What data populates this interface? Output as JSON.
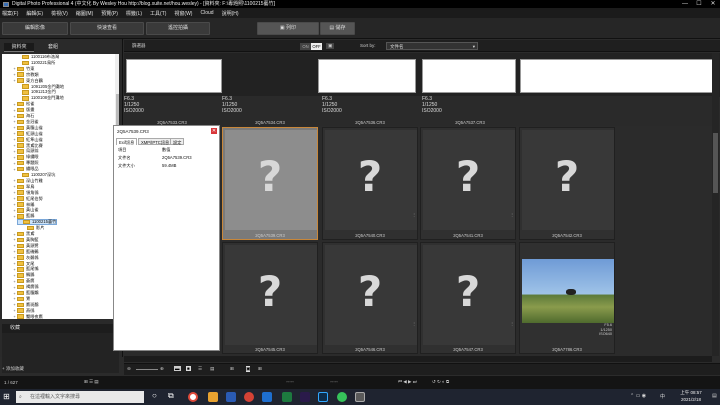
{
  "window": {
    "title": "Digital Photo Professional 4 (中文化 By Wesley Hou http://blog.xuite.net/hou.wesley) - [資料夾: F:\\專題照\\1100215藝竹]",
    "minimize": "—",
    "maximize": "☐",
    "close": "✕"
  },
  "menu": [
    "檔案(F)",
    "編輯(E)",
    "檢視(V)",
    "縮圖(M)",
    "預覽(P)",
    "標籤(L)",
    "工具(T)",
    "視窗(W)",
    "Cloud",
    "說明(H)"
  ],
  "toolbar": {
    "edit_image": "編輯影像",
    "quick_check": "快速查看",
    "batch_edit": "遙控拍攝",
    "print": "列印",
    "save": "儲存"
  },
  "left_panel": {
    "tab_folder": "資料夾",
    "tab_collection": "套組",
    "tree": [
      {
        "label": "1100116布洛灣",
        "level": 3
      },
      {
        "label": "1100221鳥所",
        "level": 3
      },
      {
        "label": "竹東",
        "level": 2
      },
      {
        "label": "宗教類",
        "level": 2
      },
      {
        "label": "東方白鸛",
        "level": 2
      },
      {
        "label": "1091205金門灘地",
        "level": 3
      },
      {
        "label": "1091213金門",
        "level": 3
      },
      {
        "label": "1100108金門灘地",
        "level": 3
      },
      {
        "label": "松雀",
        "level": 2
      },
      {
        "label": "版畫",
        "level": 2
      },
      {
        "label": "海石",
        "level": 2
      },
      {
        "label": "金冠雀",
        "level": 2
      },
      {
        "label": "黃腹山雀",
        "level": 2
      },
      {
        "label": "紅頭山雀",
        "level": 2
      },
      {
        "label": "紅隼山雀",
        "level": 2
      },
      {
        "label": "黑鳶比賽",
        "level": 2
      },
      {
        "label": "烏頭翁",
        "level": 2
      },
      {
        "label": "綠繡眼",
        "level": 2
      },
      {
        "label": "專題照",
        "level": 2
      },
      {
        "label": "繡眼品",
        "level": 2
      },
      {
        "label": "1100207深坑",
        "level": 3
      },
      {
        "label": "深山竹雞",
        "level": 2
      },
      {
        "label": "翠鳥",
        "level": 2
      },
      {
        "label": "領角鴞",
        "level": 2
      },
      {
        "label": "紅尾伯勞",
        "level": 2
      },
      {
        "label": "林鵰",
        "level": 2
      },
      {
        "label": "黃山雀",
        "level": 2
      },
      {
        "label": "藍鵲",
        "level": 2
      },
      {
        "label": "1100215藝竹",
        "level": 3,
        "selected": true
      },
      {
        "label": "影片",
        "level": 4
      },
      {
        "label": "黑鳶",
        "level": 2
      },
      {
        "label": "黃胸藍",
        "level": 2
      },
      {
        "label": "黃頭鷺",
        "level": 2
      },
      {
        "label": "藍磯鶇",
        "level": 2
      },
      {
        "label": "灰鶺鴒",
        "level": 2
      },
      {
        "label": "叉尾",
        "level": 2
      },
      {
        "label": "藍尾鴝",
        "level": 2
      },
      {
        "label": "鵂鶹",
        "level": 2
      },
      {
        "label": "蒼鷹",
        "level": 2
      },
      {
        "label": "褐鷹鴞",
        "level": 2
      },
      {
        "label": "藍腹鷴",
        "level": 2
      },
      {
        "label": "鵟",
        "level": 2
      },
      {
        "label": "鷹斑鷸",
        "level": 2
      },
      {
        "label": "燕鴴",
        "level": 2
      },
      {
        "label": "蟹眼夜鷹",
        "level": 2
      }
    ],
    "favorites_tab": "收藏",
    "add_favorite": "+ 添加收藏"
  },
  "filter_bar": {
    "filter_label": "篩選器",
    "toggle_on": "ON",
    "toggle_off": "OFF",
    "sort_label": "Sort by:",
    "sort_value": "文件名"
  },
  "top_row": [
    {
      "name": "2Q5A7533.CR3",
      "exif": [
        "F6.3",
        "1/1250",
        "ISO2000"
      ]
    },
    {
      "name": "2Q5A7534.CR3",
      "exif": [
        "F6.3",
        "1/1250",
        "ISO2000"
      ]
    },
    {
      "name": "2Q5A7536.CR3",
      "exif": [
        "F6.3",
        "1/1250",
        "ISO2000"
      ]
    },
    {
      "name": "2Q5A7537.CR3",
      "exif": [
        "F6.3",
        "1/1250",
        "ISO2000"
      ]
    }
  ],
  "grid_row1": [
    {
      "name": "2Q5A7539.CR3",
      "selected": true
    },
    {
      "name": "2Q5A7540.CR3"
    },
    {
      "name": "2Q5A7541.CR3"
    },
    {
      "name": "2Q5A7542.CR3"
    }
  ],
  "grid_row2": [
    {
      "name": "2Q5A7545.CR3"
    },
    {
      "name": "2Q5A7546.CR3"
    },
    {
      "name": "2Q5A7547.CR3"
    },
    {
      "name": "2Q5A7786.CR3",
      "photo": true,
      "exif": [
        "F5.6",
        "1/1250",
        "ISO640"
      ]
    }
  ],
  "placeholder_glyph": "?",
  "info_panel": {
    "title": "2Q5A7539.CR3",
    "tabs": [
      "Exif訊息",
      "XMP/IPTC訊息",
      "設定"
    ],
    "rows": [
      {
        "k": "項目",
        "v": "數值"
      },
      {
        "k": "文件名",
        "v": "2Q5A7539.CR3"
      },
      {
        "k": "文件大小",
        "v": "59.4MB"
      }
    ],
    "close": "✕"
  },
  "status": {
    "count": "1 / 627"
  },
  "taskbar": {
    "search_placeholder": "在這裡輸入文字來搜尋",
    "time": "上午 08:57",
    "date": "2021/2/18",
    "lang": "中"
  },
  "colors": {
    "selection": "#c8873a",
    "accent": "#3a6fb5"
  }
}
